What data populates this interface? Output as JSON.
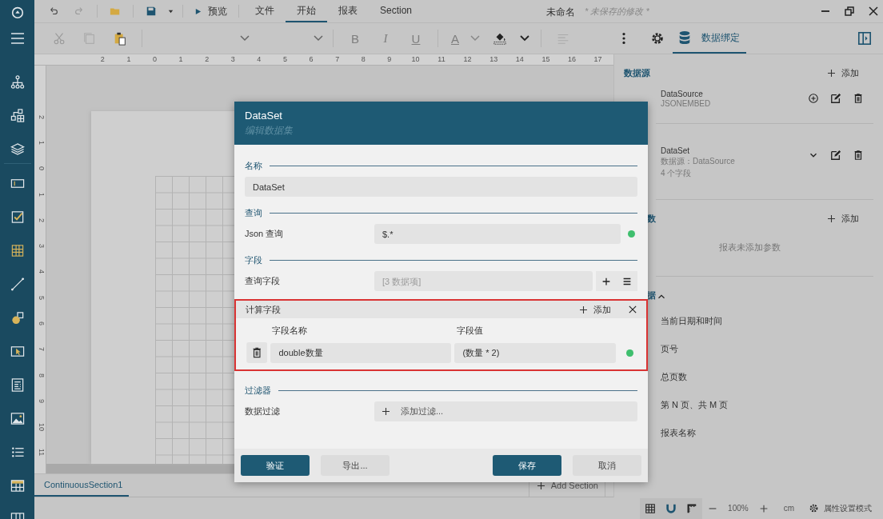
{
  "titlebar": {
    "preview": "预览",
    "menus": [
      {
        "label": "文件",
        "selected": false
      },
      {
        "label": "开始",
        "selected": true
      },
      {
        "label": "报表",
        "selected": false
      },
      {
        "label": "Section",
        "selected": false
      }
    ],
    "title": "未命名",
    "unsaved": "* 未保存的修改 *"
  },
  "toolbar": {
    "format": [
      "B",
      "I",
      "U"
    ],
    "font_color": "A",
    "panel_tab": {
      "label": "数据绑定",
      "selected": true
    }
  },
  "ruler": {
    "horizontal": [
      "2",
      "1",
      "0",
      "1",
      "2",
      "3",
      "4",
      "5",
      "6",
      "7",
      "8",
      "9",
      "10",
      "11",
      "12",
      "13",
      "14",
      "15",
      "16",
      "17"
    ],
    "vertical": [
      "2",
      "1",
      "0",
      "1",
      "2",
      "3",
      "4",
      "5",
      "6",
      "7",
      "8",
      "9",
      "10",
      "11"
    ]
  },
  "right_panel": {
    "data_sources": {
      "heading": "数据源",
      "add": "添加",
      "items": [
        {
          "name": "DataSource",
          "type": "JSONEMBED"
        }
      ]
    },
    "data_sets": {
      "items": [
        {
          "name": "DataSet",
          "source": "数据源：DataSource",
          "fields": "4 个字段"
        }
      ]
    },
    "parameters": {
      "heading": "数",
      "add": "添加",
      "empty": "报表未添加参数"
    },
    "system": {
      "heading": "据",
      "expanded": true,
      "items": [
        "当前日期和时间",
        "页号",
        "总页数",
        "第 N 页、共 M 页",
        "报表名称"
      ]
    }
  },
  "section_tabs": [
    {
      "label": "ContinuousSection1",
      "selected": true
    }
  ],
  "add_section": "Add Section",
  "status_bar": {
    "zoom": "100%",
    "unit": "cm",
    "mode": "属性设置模式"
  },
  "dialog": {
    "title": "DataSet",
    "subtitle": "编辑数据集",
    "name": {
      "heading": "名称",
      "value": "DataSet"
    },
    "query": {
      "heading": "查询",
      "label": "Json 查询",
      "value": "$.*",
      "valid": true
    },
    "fields": {
      "heading": "字段",
      "label": "查询字段",
      "placeholder": "[3 数据项]"
    },
    "calculated": {
      "heading": "计算字段",
      "add": "添加",
      "highlighted": true,
      "columns": [
        "字段名称",
        "字段值"
      ],
      "rows": [
        {
          "name": "double数量",
          "value": "(数量 * 2)",
          "valid": true
        }
      ]
    },
    "filter": {
      "heading": "过滤器",
      "label": "数据过滤",
      "add": "添加过滤..."
    },
    "buttons": [
      {
        "label": "验证",
        "primary": true
      },
      {
        "label": "导出...",
        "primary": false
      },
      {
        "label": "保存",
        "primary": true
      },
      {
        "label": "取消",
        "primary": false
      }
    ]
  }
}
